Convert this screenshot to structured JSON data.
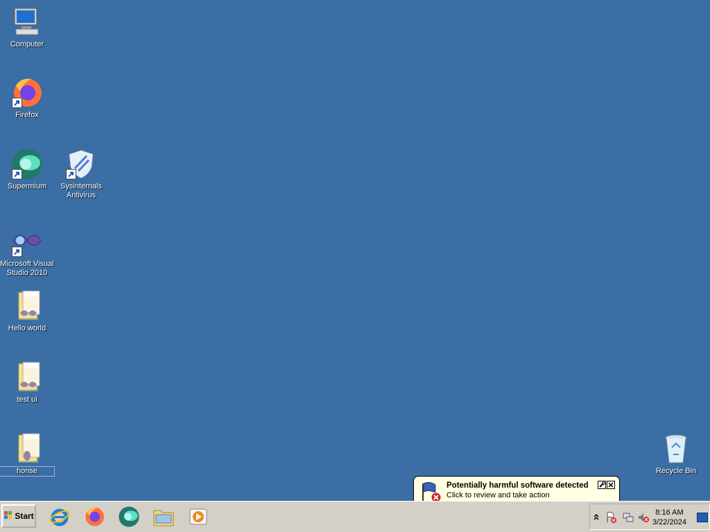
{
  "desktop": {
    "icons": [
      {
        "label": "Computer",
        "icon": "computer-icon"
      },
      {
        "label": "Firefox",
        "icon": "firefox-icon"
      },
      {
        "label": "Supermium",
        "icon": "supermium-icon"
      },
      {
        "label": "Sysinternals Antivirus",
        "icon": "shield-icon"
      },
      {
        "label": "Microsoft Visual Studio 2010",
        "icon": "visual-studio-icon"
      },
      {
        "label": "Hello world",
        "icon": "folder-icon"
      },
      {
        "label": "test ui",
        "icon": "folder-icon"
      },
      {
        "label": "honse",
        "icon": "folder-icon"
      },
      {
        "label": "Recycle Bin",
        "icon": "recycle-bin-icon"
      }
    ]
  },
  "taskbar": {
    "start_label": "Start",
    "quick_launch": [
      "internet-explorer-icon",
      "firefox-icon",
      "supermium-icon",
      "explorer-folder-icon",
      "media-player-icon"
    ],
    "tray": {
      "clock_time": "8:16 AM",
      "clock_date": "3/22/2024"
    }
  },
  "notification": {
    "title": "Potentially harmful software detected",
    "body": "Click to review and take action"
  },
  "colors": {
    "desktop_bg": "#3a6ea5",
    "taskbar_bg": "#d4d0c8",
    "balloon_bg": "#ffffe1"
  }
}
